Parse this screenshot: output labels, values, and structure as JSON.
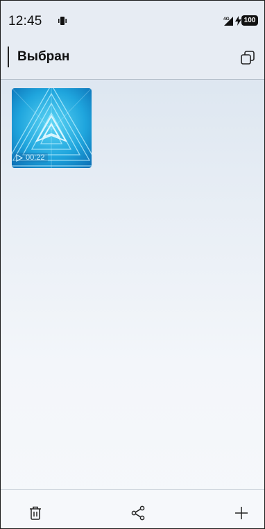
{
  "status_bar": {
    "time": "12:45",
    "network": "4G",
    "battery": "100",
    "icons": [
      "vibrate-icon",
      "signal-icon",
      "charging-icon",
      "battery-icon"
    ]
  },
  "header": {
    "title": "Выбран",
    "icons": [
      "copy-icon"
    ]
  },
  "items": [
    {
      "type": "video",
      "duration": "00:22"
    }
  ],
  "bottom_bar": {
    "icons": [
      "trash-icon",
      "share-icon",
      "plus-icon"
    ]
  },
  "colors": {
    "accent_thumbnail": "#1f9fd8",
    "header_background": "#e7ecf3",
    "text": "#111111"
  }
}
